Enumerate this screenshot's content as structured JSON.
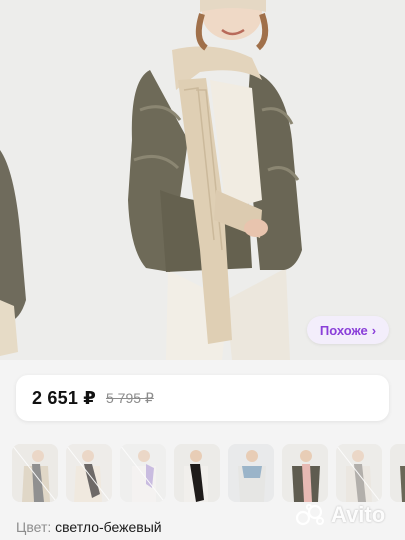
{
  "hero": {
    "similar_label": "Похоже",
    "similar_icon": "chevron-right-icon"
  },
  "price": {
    "current": "2 651 ₽",
    "old": "5 795 ₽"
  },
  "swatches": [
    {
      "name": "swatch-1",
      "disabled": true
    },
    {
      "name": "swatch-2",
      "disabled": true
    },
    {
      "name": "swatch-3",
      "disabled": true
    },
    {
      "name": "swatch-4",
      "disabled": false
    },
    {
      "name": "swatch-5",
      "disabled": false
    },
    {
      "name": "swatch-6",
      "disabled": false
    },
    {
      "name": "swatch-7",
      "disabled": false
    },
    {
      "name": "swatch-8",
      "disabled": false
    }
  ],
  "color": {
    "label": "Цвет:",
    "value": "светло-бежевый"
  },
  "watermark": {
    "text": "Avito"
  },
  "colors": {
    "accent": "#8a3fd9",
    "similar_bg": "#f3eefb",
    "page_bg": "#f4f4f4",
    "price_old": "#8c8c8c"
  }
}
